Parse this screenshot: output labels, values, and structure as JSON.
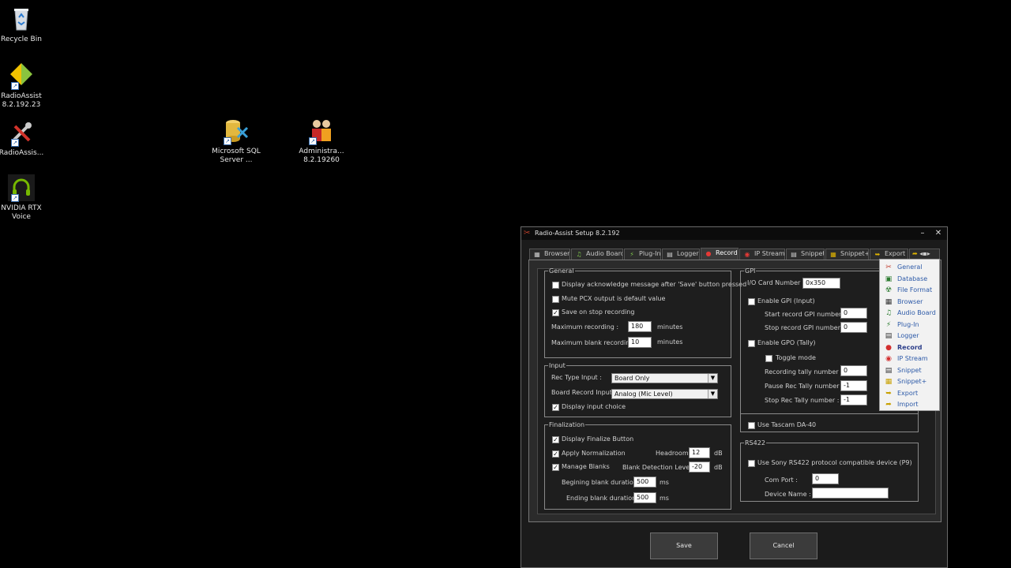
{
  "desktop": {
    "icons": [
      {
        "label": "Recycle Bin"
      },
      {
        "label": "RadioAssist 8.2.192.23"
      },
      {
        "label": "RadioAssis..."
      },
      {
        "label": "NVIDIA RTX Voice"
      },
      {
        "label": "Microsoft SQL Server ..."
      },
      {
        "label": "Administra... 8.2.19260"
      }
    ]
  },
  "window": {
    "title": "Radio-Assist Setup 8.2.192",
    "minimize": "–",
    "close": "✕",
    "tabs": [
      {
        "label": "Browser"
      },
      {
        "label": "Audio Board"
      },
      {
        "label": "Plug-In"
      },
      {
        "label": "Logger"
      },
      {
        "label": "Record"
      },
      {
        "label": "IP Stream"
      },
      {
        "label": "Snippet"
      },
      {
        "label": "Snippet+"
      },
      {
        "label": "Export"
      }
    ],
    "general": {
      "legend": "General",
      "ack_label": "Display acknowledge message after 'Save' button pressed",
      "mute_label": "Mute PCX output is default value",
      "save_stop_label": "Save on stop recording",
      "max_rec_label": "Maximum recording :",
      "max_rec_value": "180",
      "max_rec_unit": "minutes",
      "max_blank_label": "Maximum blank recording :",
      "max_blank_value": "10",
      "max_blank_unit": "minutes"
    },
    "input": {
      "legend": "Input",
      "rec_type_label": "Rec Type Input :",
      "rec_type_value": "Board Only",
      "board_rec_label": "Board Record Input :",
      "board_rec_value": "Analog (Mic Level)",
      "display_choice_label": "Display input choice"
    },
    "finalization": {
      "legend": "Finalization",
      "display_finalize_label": "Display Finalize Button",
      "apply_norm_label": "Apply Normalization",
      "headroom_label": "Headroom :",
      "headroom_value": "12",
      "headroom_unit": "dB",
      "manage_blanks_label": "Manage Blanks",
      "blank_level_label": "Blank Detection Level :",
      "blank_level_value": "-20",
      "blank_level_unit": "dB",
      "begin_blank_label": "Begining blank duration :",
      "begin_blank_value": "500",
      "begin_blank_unit": "ms",
      "end_blank_label": "Ending blank duration :",
      "end_blank_value": "500",
      "end_blank_unit": "ms"
    },
    "gpi": {
      "legend": "GPI",
      "io_card_label": "I/O Card Number :",
      "io_card_value": "0x350",
      "enable_gpi_label": "Enable GPI (Input)",
      "start_rec_label": "Start record GPI number :",
      "start_rec_value": "0",
      "stop_rec_label": "Stop record GPI number :",
      "stop_rec_value": "0",
      "enable_gpo_label": "Enable GPO (Tally)",
      "toggle_label": "Toggle mode",
      "rec_tally_label": "Recording tally number :",
      "rec_tally_value": "0",
      "pause_tally_label": "Pause Rec Tally number :",
      "pause_tally_value": "-1",
      "stop_tally_label": "Stop Rec Tally number :",
      "stop_tally_value": "-1"
    },
    "tascam_label": "Use Tascam DA-40",
    "rs422": {
      "legend": "RS422",
      "sony_label": "Use Sony RS422 protocol compatible device (P9)",
      "com_port_label": "Com Port :",
      "com_port_value": "0",
      "device_name_label": "Device Name :",
      "device_name_value": ""
    },
    "menu": [
      {
        "label": "General",
        "icon": "general-icon",
        "color": "#c0392b"
      },
      {
        "label": "Database",
        "icon": "database-icon",
        "color": "#2e7d32"
      },
      {
        "label": "File Format",
        "icon": "radiation-icon",
        "color": "#2e7d32"
      },
      {
        "label": "Browser",
        "icon": "browser-icon",
        "color": "#333333"
      },
      {
        "label": "Audio Board",
        "icon": "audio-board-icon",
        "color": "#2e7d32"
      },
      {
        "label": "Plug-In",
        "icon": "plug-in-icon",
        "color": "#2e7d32"
      },
      {
        "label": "Logger",
        "icon": "logger-icon",
        "color": "#333333"
      },
      {
        "label": "Record",
        "icon": "record-icon",
        "color": "#d32f2f"
      },
      {
        "label": "IP Stream",
        "icon": "ip-stream-icon",
        "color": "#d32f2f"
      },
      {
        "label": "Snippet",
        "icon": "snippet-icon",
        "color": "#333333"
      },
      {
        "label": "Snippet+",
        "icon": "snippet-plus-icon",
        "color": "#c8a000"
      },
      {
        "label": "Export",
        "icon": "export-icon",
        "color": "#c8a000"
      },
      {
        "label": "Import",
        "icon": "import-icon",
        "color": "#c8a000"
      }
    ],
    "save_label": "Save",
    "cancel_label": "Cancel"
  }
}
